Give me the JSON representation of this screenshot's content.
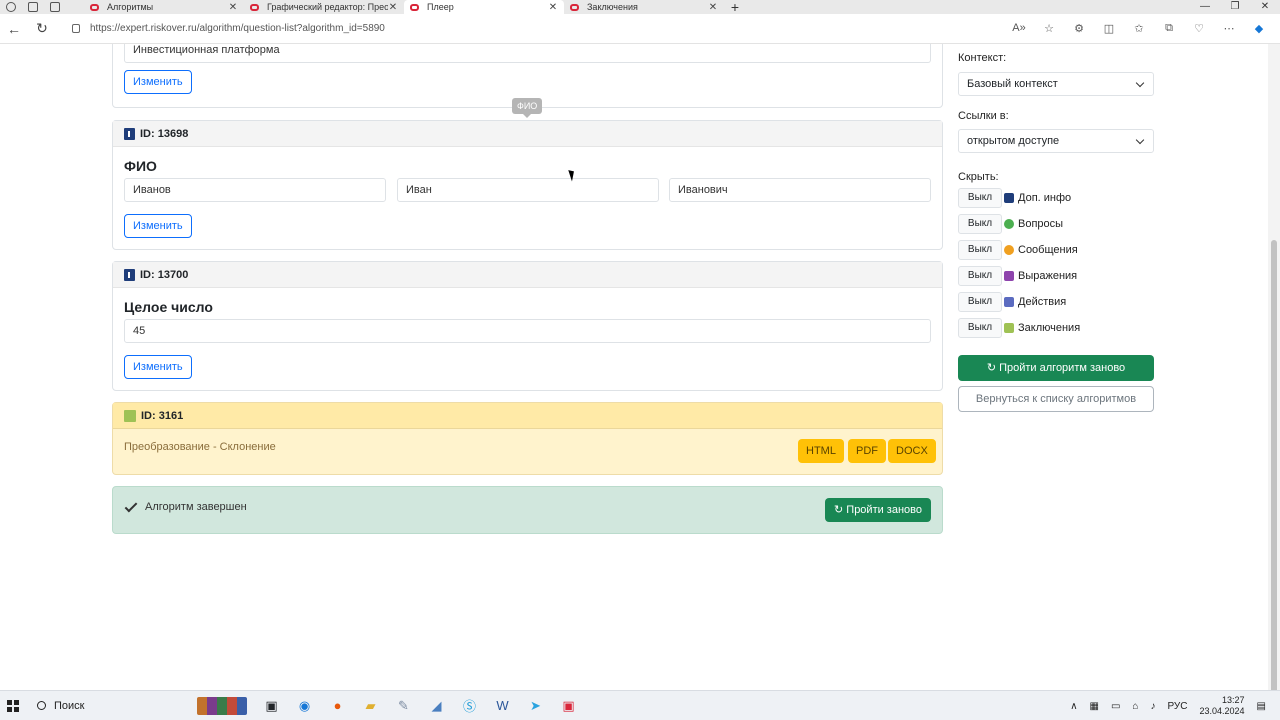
{
  "browser": {
    "tabs": [
      {
        "title": "Алгоритмы",
        "active": false
      },
      {
        "title": "Графический редактор: Преоб",
        "active": false
      },
      {
        "title": "Плеер",
        "active": true
      },
      {
        "title": "Заключения",
        "active": false
      }
    ],
    "url": "https://expert.riskover.ru/algorithm/question-list?algorithm_id=5890"
  },
  "main": {
    "top_card": {
      "value": "Инвестиционная платформа",
      "change_label": "Изменить"
    },
    "tooltip": "ФИО",
    "fio_card": {
      "id_label": "ID: 13698",
      "title": "ФИО",
      "surname": "Иванов",
      "name": "Иван",
      "patronymic": "Иванович",
      "change_label": "Изменить"
    },
    "int_card": {
      "id_label": "ID: 13700",
      "title": "Целое число",
      "value": "45",
      "change_label": "Изменить"
    },
    "conclusion_card": {
      "id_label": "ID: 3161",
      "text": "Преобразование - Склонение",
      "buttons": [
        "HTML",
        "PDF",
        "DOCX"
      ]
    },
    "done_card": {
      "text": "Алгоритм завершен",
      "restart_label": "Пройти заново"
    }
  },
  "sidebar": {
    "context_label": "Контекст:",
    "context_value": "Базовый контекст",
    "links_label": "Ссылки в:",
    "links_value": "открытом доступе",
    "hide_label": "Скрыть:",
    "hide_items": [
      {
        "button": "Выкл",
        "label": "Доп. инфо",
        "color": "#1f3d7a"
      },
      {
        "button": "Выкл",
        "label": "Вопросы",
        "color": "#4caf50"
      },
      {
        "button": "Выкл",
        "label": "Сообщения",
        "color": "#f0a020"
      },
      {
        "button": "Выкл",
        "label": "Выражения",
        "color": "#8e44ad"
      },
      {
        "button": "Выкл",
        "label": "Действия",
        "color": "#5b6bc0"
      },
      {
        "button": "Выкл",
        "label": "Заключения",
        "color": "#9fc255"
      }
    ],
    "restart_label": "Пройти алгоритм заново",
    "back_label": "Вернуться к списку алгоритмов"
  },
  "taskbar": {
    "search_label": "Поиск",
    "lang": "РУС",
    "time": "13:27",
    "date": "23.04.2024"
  }
}
